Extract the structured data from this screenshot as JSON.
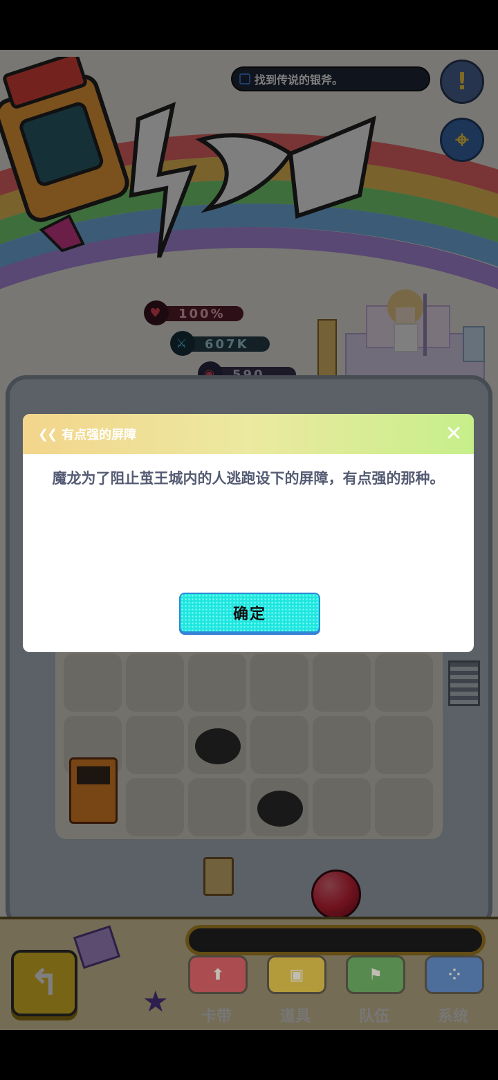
{
  "quest": {
    "text": "找到传说的银斧。"
  },
  "stats": {
    "hp": "100%",
    "attack": "607K",
    "power": "590"
  },
  "dialog": {
    "title": "有点强的屏障",
    "body": "魔龙为了阻止茧王城内的人逃跑设下的屏障，有点强的那种。",
    "confirm_label": "确定",
    "close_symbol": "✕",
    "chain_symbol": "❮❮"
  },
  "nav": {
    "items": [
      {
        "label": "卡带",
        "icon": "up-arrow-icon",
        "symbol": "⬆"
      },
      {
        "label": "道具",
        "icon": "bag-icon",
        "symbol": "▣"
      },
      {
        "label": "队伍",
        "icon": "flag-icon",
        "symbol": "⚑"
      },
      {
        "label": "系统",
        "icon": "grid-dots-icon",
        "symbol": "⁘"
      }
    ],
    "back_symbol": "↰",
    "star_symbol": "★",
    "side_symbols": {
      "alert": "!",
      "map": "⌖"
    }
  },
  "colors": {
    "dialog_header_start": "#f3d58c",
    "dialog_header_end": "#c6ef8a",
    "confirm_button": "#1fe6df",
    "nav_red": "#d8324f",
    "nav_yellow": "#e7c32a",
    "nav_green": "#3fa34a",
    "nav_blue": "#2f6fd6"
  }
}
